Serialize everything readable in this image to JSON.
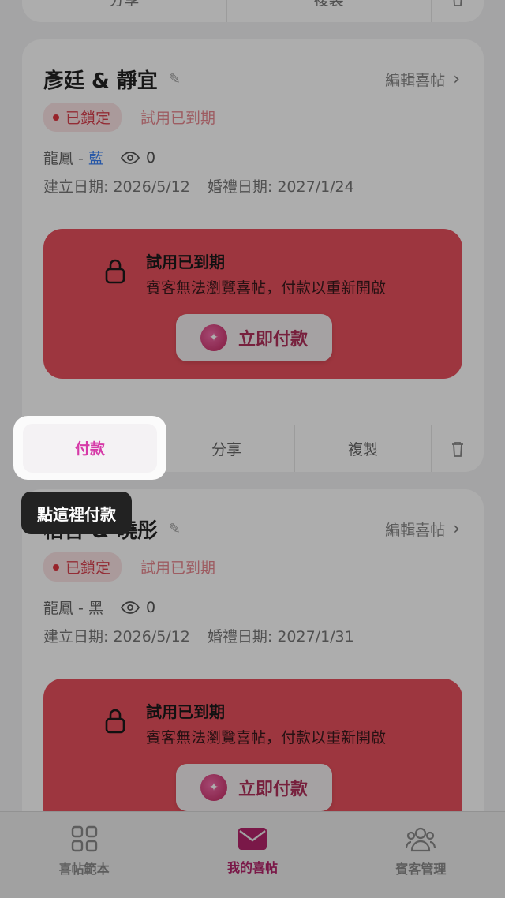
{
  "top_card": {
    "actions": [
      "分享",
      "複製"
    ]
  },
  "cards": [
    {
      "title": "彥廷 & 靜宜",
      "edit_label": "編輯喜帖",
      "locked_badge": "已鎖定",
      "status_text": "試用已到期",
      "style_prefix": "龍鳳 - ",
      "style_color": "藍",
      "views": "0",
      "created": "建立日期: 2026/5/12",
      "wedding": "婚禮日期: 2027/1/24",
      "alert_title": "試用已到期",
      "alert_desc": "賓客無法瀏覽喜帖，付款以重新開啟",
      "pay_button": "立即付款",
      "actions": [
        "付款",
        "分享",
        "複製"
      ]
    },
    {
      "title": "柏言 & 曉彤",
      "edit_label": "編輯喜帖",
      "locked_badge": "已鎖定",
      "status_text": "試用已到期",
      "style_prefix": "龍鳳 - ",
      "style_color": "黑",
      "views": "0",
      "created": "建立日期: 2026/5/12",
      "wedding": "婚禮日期: 2027/1/31",
      "alert_title": "試用已到期",
      "alert_desc": "賓客無法瀏覽喜帖，付款以重新開啟",
      "pay_button": "立即付款"
    }
  ],
  "spotlight": {
    "label": "付款"
  },
  "tooltip": {
    "text": "點這裡付款"
  },
  "bottom_nav": [
    {
      "label": "喜帖範本",
      "icon": "grid-icon"
    },
    {
      "label": "我的喜帖",
      "icon": "envelope-icon",
      "active": true
    },
    {
      "label": "賓客管理",
      "icon": "people-icon"
    }
  ],
  "colors": {
    "accent": "#b4246a",
    "alert_bg": "#e8505d",
    "tooltip_bg": "#222222"
  }
}
